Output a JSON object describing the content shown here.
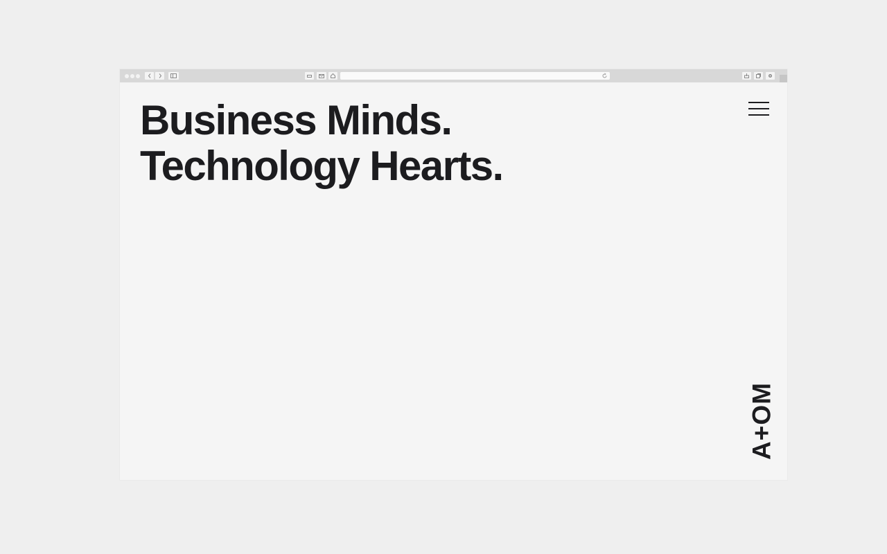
{
  "browser": {
    "window_controls": [
      "close",
      "minimize",
      "zoom"
    ],
    "nav_icons": [
      "back-arrow-icon",
      "forward-arrow-icon",
      "sidebar-icon"
    ],
    "toolbar_icons": [
      "print-icon",
      "mail-icon",
      "home-icon"
    ],
    "url_value": "",
    "reload_icon": "reload-icon",
    "right_icons": [
      "share-icon",
      "tabs-icon",
      "settings-icon"
    ]
  },
  "hero": {
    "line1": "Business Minds.",
    "line2": "Technology Hearts."
  },
  "header": {
    "menu_icon": "hamburger-menu-icon"
  },
  "brand": {
    "logo_text": "A+OM"
  },
  "colors": {
    "page_bg": "#efefef",
    "content_bg": "#f5f5f5",
    "chrome_bg": "#d8d8d8",
    "text": "#1c1c1f"
  }
}
